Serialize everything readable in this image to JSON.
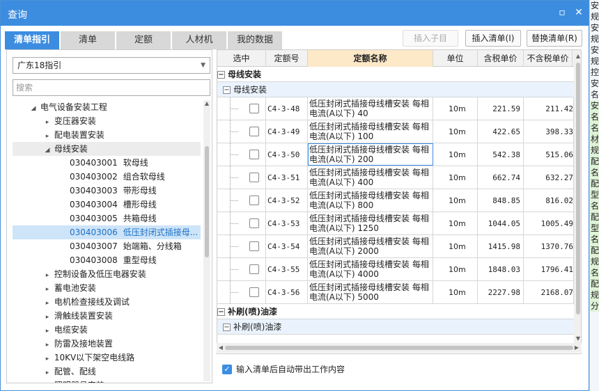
{
  "window": {
    "title": "查询",
    "restore_icon": "restore-icon",
    "close_icon": "close-icon"
  },
  "tabs": [
    {
      "label": "清单指引",
      "active": true
    },
    {
      "label": "清单",
      "active": false
    },
    {
      "label": "定额",
      "active": false
    },
    {
      "label": "人材机",
      "active": false
    },
    {
      "label": "我的数据",
      "active": false
    }
  ],
  "toolbar": {
    "insert_child": "插入子目",
    "insert_list": "插入清单(I)",
    "replace_list": "替换清单(R)"
  },
  "left": {
    "guide_select": "广东18指引",
    "search_placeholder": "搜索",
    "tree": [
      {
        "indent": 1,
        "arrow": "◢",
        "label": "电气设备安装工程"
      },
      {
        "indent": 2,
        "arrow": "▸",
        "label": "变压器安装"
      },
      {
        "indent": 2,
        "arrow": "▸",
        "label": "配电装置安装"
      },
      {
        "indent": 2,
        "arrow": "◢",
        "label": "母线安装",
        "hover": true
      },
      {
        "indent": 3,
        "arrow": "",
        "code": "030403001",
        "label": "软母线"
      },
      {
        "indent": 3,
        "arrow": "",
        "code": "030403002",
        "label": "组合软母线"
      },
      {
        "indent": 3,
        "arrow": "",
        "code": "030403003",
        "label": "带形母线"
      },
      {
        "indent": 3,
        "arrow": "",
        "code": "030403004",
        "label": "槽形母线"
      },
      {
        "indent": 3,
        "arrow": "",
        "code": "030403005",
        "label": "共箱母线"
      },
      {
        "indent": 3,
        "arrow": "",
        "code": "030403006",
        "label": "低压封闭式插接母...",
        "selected": true
      },
      {
        "indent": 3,
        "arrow": "",
        "code": "030403007",
        "label": "始端箱、分线箱"
      },
      {
        "indent": 3,
        "arrow": "",
        "code": "030403008",
        "label": "重型母线"
      },
      {
        "indent": 2,
        "arrow": "▸",
        "label": "控制设备及低压电器安装"
      },
      {
        "indent": 2,
        "arrow": "▸",
        "label": "蓄电池安装"
      },
      {
        "indent": 2,
        "arrow": "▸",
        "label": "电机检查接线及调试"
      },
      {
        "indent": 2,
        "arrow": "▸",
        "label": "滑触线装置安装"
      },
      {
        "indent": 2,
        "arrow": "▸",
        "label": "电缆安装"
      },
      {
        "indent": 2,
        "arrow": "▸",
        "label": "防雷及接地装置"
      },
      {
        "indent": 2,
        "arrow": "▸",
        "label": "10KV以下架空电线路"
      },
      {
        "indent": 2,
        "arrow": "▸",
        "label": "配管、配线"
      },
      {
        "indent": 2,
        "arrow": "▸",
        "label": "照明器具安装"
      }
    ]
  },
  "grid": {
    "headers": [
      "选中",
      "定额号",
      "定额名称",
      "单位",
      "含税单价",
      "不含税单价"
    ],
    "group1": "母线安装",
    "group1_sub": "母线安装",
    "rows": [
      {
        "code": "C4-3-48",
        "name": "低压封闭式插接母线槽安装 每相电流(A以下) 40",
        "unit": "10m",
        "tax_price": "221.59",
        "notax_price": "211.42"
      },
      {
        "code": "C4-3-49",
        "name": "低压封闭式插接母线槽安装 每相电流(A以下) 100",
        "unit": "10m",
        "tax_price": "422.65",
        "notax_price": "398.33"
      },
      {
        "code": "C4-3-50",
        "name": "低压封闭式插接母线槽安装 每相电流(A以下) 200",
        "unit": "10m",
        "tax_price": "542.38",
        "notax_price": "515.06",
        "focused": true
      },
      {
        "code": "C4-3-51",
        "name": "低压封闭式插接母线槽安装 每相电流(A以下) 400",
        "unit": "10m",
        "tax_price": "662.74",
        "notax_price": "632.27"
      },
      {
        "code": "C4-3-52",
        "name": "低压封闭式插接母线槽安装 每相电流(A以下) 800",
        "unit": "10m",
        "tax_price": "848.85",
        "notax_price": "816.02"
      },
      {
        "code": "C4-3-53",
        "name": "低压封闭式插接母线槽安装 每相电流(A以下) 1250",
        "unit": "10m",
        "tax_price": "1044.05",
        "notax_price": "1005.49"
      },
      {
        "code": "C4-3-54",
        "name": "低压封闭式插接母线槽安装 每相电流(A以下) 2000",
        "unit": "10m",
        "tax_price": "1415.98",
        "notax_price": "1370.76"
      },
      {
        "code": "C4-3-55",
        "name": "低压封闭式插接母线槽安装 每相电流(A以下) 4000",
        "unit": "10m",
        "tax_price": "1848.03",
        "notax_price": "1796.41"
      },
      {
        "code": "C4-3-56",
        "name": "低压封闭式插接母线槽安装 每相电流(A以下) 5000",
        "unit": "10m",
        "tax_price": "2227.98",
        "notax_price": "2168.07"
      }
    ],
    "group2": "补刷(喷)油漆",
    "group2_sub": "补刷(喷)油漆"
  },
  "footer": {
    "auto_content_label": "输入清单后自动带出工作内容",
    "auto_content_checked": true
  },
  "side_strip": [
    "安",
    "规",
    "安",
    "规",
    "安",
    "规",
    "控",
    "安",
    "名",
    "安",
    "名",
    "名",
    "材",
    "规",
    "配",
    "名",
    "配",
    "型",
    "名",
    "配",
    "型",
    "名",
    "配",
    "规",
    "名",
    "配",
    "规",
    "分"
  ]
}
